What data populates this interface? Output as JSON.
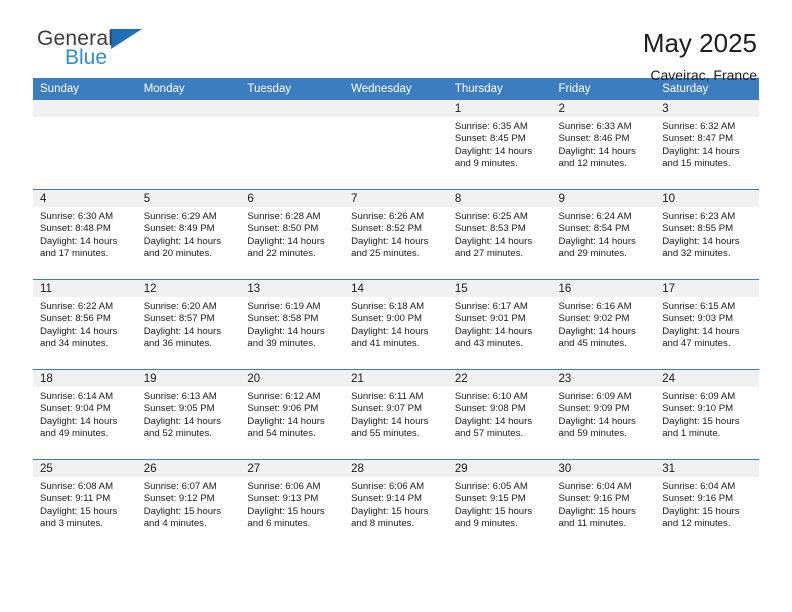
{
  "brand": {
    "name_part1": "General",
    "name_part2": "Blue",
    "accent_color": "#1d70b8",
    "secondary_color": "#2e8fd4"
  },
  "header": {
    "title": "May 2025",
    "subtitle": "Caveirac, France"
  },
  "theme": {
    "header_bg": "#3b7dbf",
    "date_strip_bg": "#f1f1f1",
    "grid_line": "#3b7dbf"
  },
  "weekday_headers": [
    "Sunday",
    "Monday",
    "Tuesday",
    "Wednesday",
    "Thursday",
    "Friday",
    "Saturday"
  ],
  "labels": {
    "sunrise": "Sunrise:",
    "sunset": "Sunset:",
    "daylight": "Daylight:"
  },
  "weeks": [
    [
      {
        "date": "",
        "empty": true
      },
      {
        "date": "",
        "empty": true
      },
      {
        "date": "",
        "empty": true
      },
      {
        "date": "",
        "empty": true
      },
      {
        "date": "1",
        "sunrise": "Sunrise: 6:35 AM",
        "sunset": "Sunset: 8:45 PM",
        "daylight": "Daylight: 14 hours and 9 minutes."
      },
      {
        "date": "2",
        "sunrise": "Sunrise: 6:33 AM",
        "sunset": "Sunset: 8:46 PM",
        "daylight": "Daylight: 14 hours and 12 minutes."
      },
      {
        "date": "3",
        "sunrise": "Sunrise: 6:32 AM",
        "sunset": "Sunset: 8:47 PM",
        "daylight": "Daylight: 14 hours and 15 minutes."
      }
    ],
    [
      {
        "date": "4",
        "sunrise": "Sunrise: 6:30 AM",
        "sunset": "Sunset: 8:48 PM",
        "daylight": "Daylight: 14 hours and 17 minutes."
      },
      {
        "date": "5",
        "sunrise": "Sunrise: 6:29 AM",
        "sunset": "Sunset: 8:49 PM",
        "daylight": "Daylight: 14 hours and 20 minutes."
      },
      {
        "date": "6",
        "sunrise": "Sunrise: 6:28 AM",
        "sunset": "Sunset: 8:50 PM",
        "daylight": "Daylight: 14 hours and 22 minutes."
      },
      {
        "date": "7",
        "sunrise": "Sunrise: 6:26 AM",
        "sunset": "Sunset: 8:52 PM",
        "daylight": "Daylight: 14 hours and 25 minutes."
      },
      {
        "date": "8",
        "sunrise": "Sunrise: 6:25 AM",
        "sunset": "Sunset: 8:53 PM",
        "daylight": "Daylight: 14 hours and 27 minutes."
      },
      {
        "date": "9",
        "sunrise": "Sunrise: 6:24 AM",
        "sunset": "Sunset: 8:54 PM",
        "daylight": "Daylight: 14 hours and 29 minutes."
      },
      {
        "date": "10",
        "sunrise": "Sunrise: 6:23 AM",
        "sunset": "Sunset: 8:55 PM",
        "daylight": "Daylight: 14 hours and 32 minutes."
      }
    ],
    [
      {
        "date": "11",
        "sunrise": "Sunrise: 6:22 AM",
        "sunset": "Sunset: 8:56 PM",
        "daylight": "Daylight: 14 hours and 34 minutes."
      },
      {
        "date": "12",
        "sunrise": "Sunrise: 6:20 AM",
        "sunset": "Sunset: 8:57 PM",
        "daylight": "Daylight: 14 hours and 36 minutes."
      },
      {
        "date": "13",
        "sunrise": "Sunrise: 6:19 AM",
        "sunset": "Sunset: 8:58 PM",
        "daylight": "Daylight: 14 hours and 39 minutes."
      },
      {
        "date": "14",
        "sunrise": "Sunrise: 6:18 AM",
        "sunset": "Sunset: 9:00 PM",
        "daylight": "Daylight: 14 hours and 41 minutes."
      },
      {
        "date": "15",
        "sunrise": "Sunrise: 6:17 AM",
        "sunset": "Sunset: 9:01 PM",
        "daylight": "Daylight: 14 hours and 43 minutes."
      },
      {
        "date": "16",
        "sunrise": "Sunrise: 6:16 AM",
        "sunset": "Sunset: 9:02 PM",
        "daylight": "Daylight: 14 hours and 45 minutes."
      },
      {
        "date": "17",
        "sunrise": "Sunrise: 6:15 AM",
        "sunset": "Sunset: 9:03 PM",
        "daylight": "Daylight: 14 hours and 47 minutes."
      }
    ],
    [
      {
        "date": "18",
        "sunrise": "Sunrise: 6:14 AM",
        "sunset": "Sunset: 9:04 PM",
        "daylight": "Daylight: 14 hours and 49 minutes."
      },
      {
        "date": "19",
        "sunrise": "Sunrise: 6:13 AM",
        "sunset": "Sunset: 9:05 PM",
        "daylight": "Daylight: 14 hours and 52 minutes."
      },
      {
        "date": "20",
        "sunrise": "Sunrise: 6:12 AM",
        "sunset": "Sunset: 9:06 PM",
        "daylight": "Daylight: 14 hours and 54 minutes."
      },
      {
        "date": "21",
        "sunrise": "Sunrise: 6:11 AM",
        "sunset": "Sunset: 9:07 PM",
        "daylight": "Daylight: 14 hours and 55 minutes."
      },
      {
        "date": "22",
        "sunrise": "Sunrise: 6:10 AM",
        "sunset": "Sunset: 9:08 PM",
        "daylight": "Daylight: 14 hours and 57 minutes."
      },
      {
        "date": "23",
        "sunrise": "Sunrise: 6:09 AM",
        "sunset": "Sunset: 9:09 PM",
        "daylight": "Daylight: 14 hours and 59 minutes."
      },
      {
        "date": "24",
        "sunrise": "Sunrise: 6:09 AM",
        "sunset": "Sunset: 9:10 PM",
        "daylight": "Daylight: 15 hours and 1 minute."
      }
    ],
    [
      {
        "date": "25",
        "sunrise": "Sunrise: 6:08 AM",
        "sunset": "Sunset: 9:11 PM",
        "daylight": "Daylight: 15 hours and 3 minutes."
      },
      {
        "date": "26",
        "sunrise": "Sunrise: 6:07 AM",
        "sunset": "Sunset: 9:12 PM",
        "daylight": "Daylight: 15 hours and 4 minutes."
      },
      {
        "date": "27",
        "sunrise": "Sunrise: 6:06 AM",
        "sunset": "Sunset: 9:13 PM",
        "daylight": "Daylight: 15 hours and 6 minutes."
      },
      {
        "date": "28",
        "sunrise": "Sunrise: 6:06 AM",
        "sunset": "Sunset: 9:14 PM",
        "daylight": "Daylight: 15 hours and 8 minutes."
      },
      {
        "date": "29",
        "sunrise": "Sunrise: 6:05 AM",
        "sunset": "Sunset: 9:15 PM",
        "daylight": "Daylight: 15 hours and 9 minutes."
      },
      {
        "date": "30",
        "sunrise": "Sunrise: 6:04 AM",
        "sunset": "Sunset: 9:16 PM",
        "daylight": "Daylight: 15 hours and 11 minutes."
      },
      {
        "date": "31",
        "sunrise": "Sunrise: 6:04 AM",
        "sunset": "Sunset: 9:16 PM",
        "daylight": "Daylight: 15 hours and 12 minutes."
      }
    ]
  ]
}
